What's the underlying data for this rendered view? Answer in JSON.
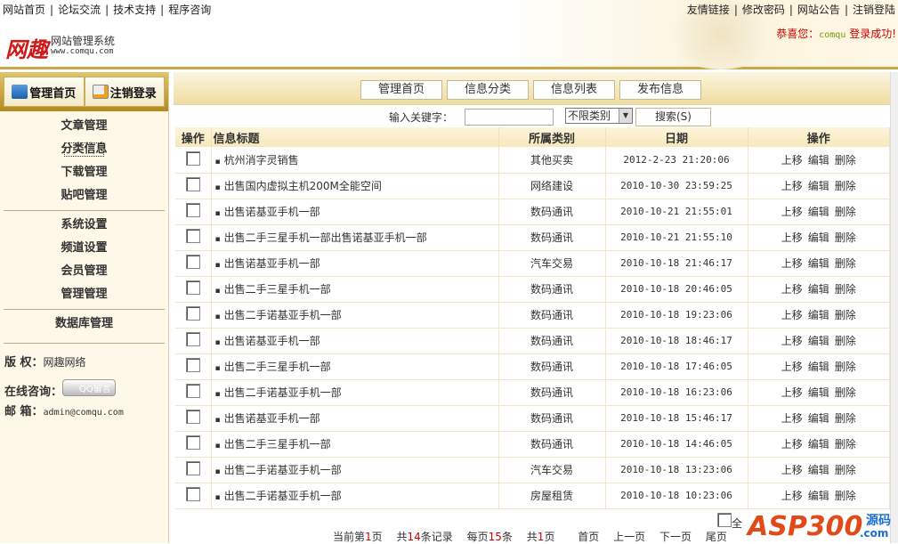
{
  "top_links_left": [
    "网站首页",
    "论坛交流",
    "技术支持",
    "程序咨询"
  ],
  "top_links_right": [
    "友情链接",
    "修改密码",
    "网站公告",
    "注销登陆"
  ],
  "separator": "|",
  "logo": {
    "mark": "网趣",
    "title": "网站管理系统",
    "url": "www.comqu.com"
  },
  "welcome": {
    "prefix": "恭喜您：",
    "user": "comqu",
    "suffix": "登录成功!"
  },
  "sidebar": {
    "buttons": [
      {
        "label": "管理首页",
        "icon": "download-icon"
      },
      {
        "label": "注销登录",
        "icon": "edit-icon"
      }
    ],
    "groups": [
      [
        "文章管理",
        "分类信息",
        "下载管理",
        "贴吧管理"
      ],
      [
        "系统设置",
        "频道设置",
        "会员管理",
        "管理管理"
      ],
      [
        "数据库管理"
      ]
    ],
    "active": "分类信息",
    "copyright_label": "版 权：",
    "copyright": "网趣网络",
    "consult_label": "在线咨询：",
    "qq_label": "QQ留言",
    "email_label": "邮 箱：",
    "email": "admin@comqu.com"
  },
  "nav": [
    "管理首页",
    "信息分类",
    "信息列表",
    "发布信息"
  ],
  "search": {
    "label": "输入关键字：",
    "value": "",
    "category": "不限类别",
    "button": "搜索(S)"
  },
  "table": {
    "headers": [
      "操作",
      "信息标题",
      "所属类别",
      "日期",
      "操作"
    ],
    "rows": [
      {
        "title": "杭州消字灵销售",
        "cat": "其他买卖",
        "date": "2012-2-23 21:20:06"
      },
      {
        "title": "出售国内虚拟主机200M全能空间",
        "cat": "网络建设",
        "date": "2010-10-30 23:59:25"
      },
      {
        "title": "出售诺基亚手机一部",
        "cat": "数码通讯",
        "date": "2010-10-21 21:55:01"
      },
      {
        "title": "出售二手三星手机一部出售诺基亚手机一部",
        "cat": "数码通讯",
        "date": "2010-10-21 21:55:10"
      },
      {
        "title": "出售诺基亚手机一部",
        "cat": "汽车交易",
        "date": "2010-10-18 21:46:17"
      },
      {
        "title": "出售二手三星手机一部",
        "cat": "数码通讯",
        "date": "2010-10-18 20:46:05"
      },
      {
        "title": "出售二手诺基亚手机一部",
        "cat": "数码通讯",
        "date": "2010-10-18 19:23:06"
      },
      {
        "title": "出售诺基亚手机一部",
        "cat": "数码通讯",
        "date": "2010-10-18 18:46:17"
      },
      {
        "title": "出售二手三星手机一部",
        "cat": "数码通讯",
        "date": "2010-10-18 17:46:05"
      },
      {
        "title": "出售二手诺基亚手机一部",
        "cat": "数码通讯",
        "date": "2010-10-18 16:23:06"
      },
      {
        "title": "出售诺基亚手机一部",
        "cat": "数码通讯",
        "date": "2010-10-18 15:46:17"
      },
      {
        "title": "出售二手三星手机一部",
        "cat": "数码通讯",
        "date": "2010-10-18 14:46:05"
      },
      {
        "title": "出售二手诺基亚手机一部",
        "cat": "汽车交易",
        "date": "2010-10-18 13:23:06"
      },
      {
        "title": "出售二手诺基亚手机一部",
        "cat": "房屋租赁",
        "date": "2010-10-18 10:23:06"
      }
    ],
    "ops": [
      "上移",
      "编辑",
      "删除"
    ],
    "bullet": "▪"
  },
  "select_all": "全",
  "pager": {
    "current_pre": "当前第",
    "current": "1",
    "current_post": "页",
    "total_pre": "共",
    "total": "14",
    "total_post": "条记录",
    "per_pre": "每页",
    "per": "15",
    "per_post": "条",
    "pages_pre": "共",
    "pages": "1",
    "pages_post": "页",
    "first": "首页",
    "prev": "上一页",
    "next": "下一页",
    "last": "尾页"
  },
  "watermark": {
    "text": "ASP300",
    "sub": "源码",
    "domain": ".com"
  },
  "colors": {
    "accent": "#c8a84a",
    "welcome": "#cc0000",
    "sidebar_bg": "#fdf8e8"
  }
}
